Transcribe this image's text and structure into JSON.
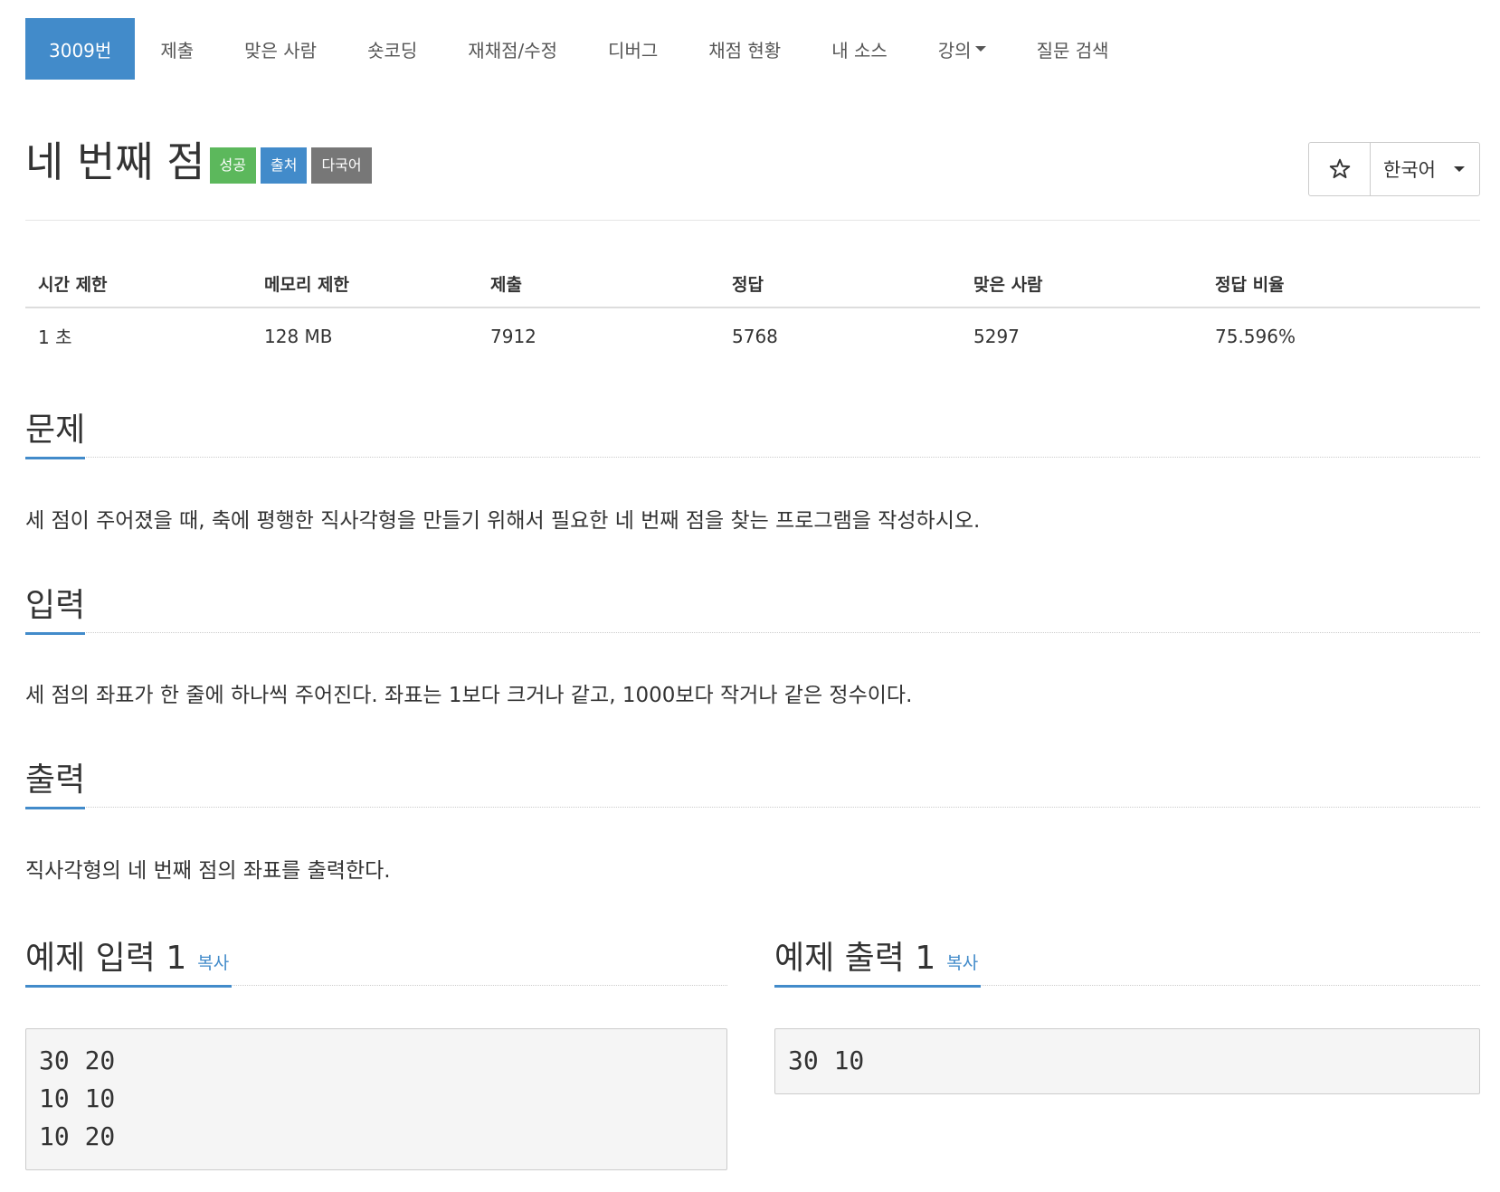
{
  "nav": {
    "items": [
      {
        "label": "3009번",
        "active": true
      },
      {
        "label": "제출"
      },
      {
        "label": "맞은 사람"
      },
      {
        "label": "숏코딩"
      },
      {
        "label": "재채점/수정"
      },
      {
        "label": "디버그"
      },
      {
        "label": "채점 현황"
      },
      {
        "label": "내 소스"
      },
      {
        "label": "강의",
        "dropdown": true
      },
      {
        "label": "질문 검색"
      }
    ]
  },
  "problem": {
    "title": "네 번째 점",
    "badges": [
      {
        "label": "성공",
        "color": "#5cb85c"
      },
      {
        "label": "출처",
        "color": "#428bca"
      },
      {
        "label": "다국어",
        "color": "#777777"
      }
    ],
    "star_icon": "star-outline-icon",
    "language": "한국어"
  },
  "stats": {
    "headers": [
      "시간 제한",
      "메모리 제한",
      "제출",
      "정답",
      "맞은 사람",
      "정답 비율"
    ],
    "values": [
      "1 초",
      "128 MB",
      "7912",
      "5768",
      "5297",
      "75.596%"
    ]
  },
  "sections": {
    "problem": {
      "heading": "문제",
      "text": "세 점이 주어졌을 때, 축에 평행한 직사각형을 만들기 위해서 필요한 네 번째 점을 찾는 프로그램을 작성하시오."
    },
    "input": {
      "heading": "입력",
      "text": "세 점의 좌표가 한 줄에 하나씩 주어진다. 좌표는 1보다 크거나 같고, 1000보다 작거나 같은 정수이다."
    },
    "output": {
      "heading": "출력",
      "text": "직사각형의 네 번째 점의 좌표를 출력한다."
    }
  },
  "samples": {
    "input": {
      "heading": "예제 입력 1",
      "copy": "복사",
      "content": "30 20\n10 10\n10 20"
    },
    "output": {
      "heading": "예제 출력 1",
      "copy": "복사",
      "content": "30 10"
    }
  },
  "colors": {
    "accent": "#428bca"
  }
}
